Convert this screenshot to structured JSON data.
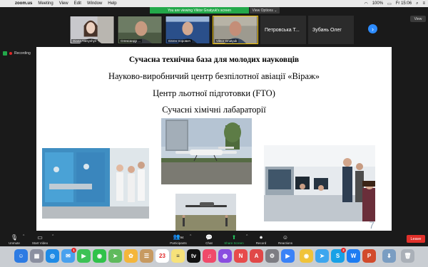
{
  "menubar": {
    "apple_icon": "apple-icon",
    "app_name": "zoom.us",
    "items": [
      "Meeting",
      "View",
      "Edit",
      "Window",
      "Help"
    ],
    "battery": "100%",
    "clock": "Fr 15:06"
  },
  "zoom": {
    "viewing_banner": "You are viewing Viktor Gnatyuk's screen",
    "view_options": "View Options ⌄",
    "view_button": "View",
    "recording_label": "Recording",
    "participants": [
      {
        "name": "Diana Yatsyshyn"
      },
      {
        "name": "Олександр ..."
      },
      {
        "name": "Євген Ігорович"
      },
      {
        "name": "Viktor Gnatyuk"
      }
    ],
    "name_tiles": [
      "Петровська Т...",
      "Зубань Олег"
    ],
    "next_icon": "chevron-right-icon"
  },
  "slide": {
    "title": "Сучасна технічна база для молодих науковців",
    "lines": [
      "Науково-виробничий центр безпілотної авіації «Віраж»",
      "Центр льотної підготовки (FTO)",
      "Сучасні хімічні лабараторії"
    ],
    "mark": "7"
  },
  "toolbar": {
    "unmute": "Unmute",
    "start_video": "Start Video",
    "participants": "Participants",
    "participants_count": "94",
    "chat": "Chat",
    "share_screen": "Share Screen",
    "record": "Record",
    "reactions": "Reactions",
    "leave": "Leave"
  },
  "dock": {
    "calendar_day": "23",
    "mail_badge": "1",
    "skype_badge": "2"
  },
  "colors": {
    "banner_green": "#23a84a",
    "zoom_blue": "#2d8cff",
    "leave_red": "#e0302a"
  }
}
